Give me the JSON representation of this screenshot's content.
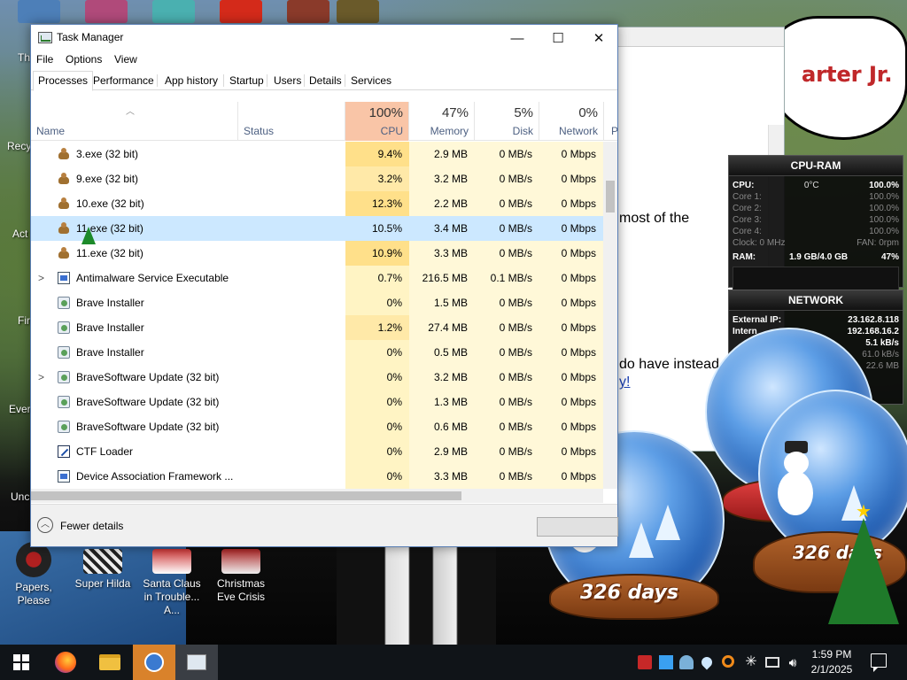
{
  "window": {
    "title": "Task Manager",
    "minimize_label": "—",
    "maximize_label": "☐",
    "close_label": "✕"
  },
  "menu": [
    "File",
    "Options",
    "View"
  ],
  "tabs": [
    "Processes",
    "Performance",
    "App history",
    "Startup",
    "Users",
    "Details",
    "Services"
  ],
  "active_tab": "Processes",
  "columns": {
    "name": "Name",
    "status": "Status",
    "cpu": {
      "pct": "100%",
      "label": "CPU"
    },
    "memory": {
      "pct": "47%",
      "label": "Memory"
    },
    "disk": {
      "pct": "5%",
      "label": "Disk"
    },
    "network": {
      "pct": "0%",
      "label": "Network"
    },
    "power_partial": "P"
  },
  "processes": [
    {
      "name": "3.exe (32 bit)",
      "icon": "poop-icon",
      "expand": "",
      "cpu": "9.4%",
      "mem": "2.9 MB",
      "disk": "0 MB/s",
      "net": "0 Mbps"
    },
    {
      "name": "9.exe (32 bit)",
      "icon": "poop-icon",
      "expand": "",
      "cpu": "3.2%",
      "mem": "3.2 MB",
      "disk": "0 MB/s",
      "net": "0 Mbps"
    },
    {
      "name": "10.exe (32 bit)",
      "icon": "poop-icon",
      "expand": "",
      "cpu": "12.3%",
      "mem": "2.2 MB",
      "disk": "0 MB/s",
      "net": "0 Mbps"
    },
    {
      "name": "11.exe (32 bit)",
      "icon": "poop-icon",
      "expand": "",
      "cpu": "10.5%",
      "mem": "3.4 MB",
      "disk": "0 MB/s",
      "net": "0 Mbps"
    },
    {
      "name": "11.exe (32 bit)",
      "icon": "poop-icon",
      "expand": "",
      "cpu": "10.9%",
      "mem": "3.3 MB",
      "disk": "0 MB/s",
      "net": "0 Mbps"
    },
    {
      "name": "Antimalware Service Executable",
      "icon": "app-window-icon",
      "expand": ">",
      "cpu": "0.7%",
      "mem": "216.5 MB",
      "disk": "0.1 MB/s",
      "net": "0 Mbps"
    },
    {
      "name": "Brave Installer",
      "icon": "installer-icon",
      "expand": "",
      "cpu": "0%",
      "mem": "1.5 MB",
      "disk": "0 MB/s",
      "net": "0 Mbps"
    },
    {
      "name": "Brave Installer",
      "icon": "installer-icon",
      "expand": "",
      "cpu": "1.2%",
      "mem": "27.4 MB",
      "disk": "0 MB/s",
      "net": "0 Mbps"
    },
    {
      "name": "Brave Installer",
      "icon": "installer-icon",
      "expand": "",
      "cpu": "0%",
      "mem": "0.5 MB",
      "disk": "0 MB/s",
      "net": "0 Mbps"
    },
    {
      "name": "BraveSoftware Update (32 bit)",
      "icon": "installer-icon",
      "expand": ">",
      "cpu": "0%",
      "mem": "3.2 MB",
      "disk": "0 MB/s",
      "net": "0 Mbps"
    },
    {
      "name": "BraveSoftware Update (32 bit)",
      "icon": "installer-icon",
      "expand": "",
      "cpu": "0%",
      "mem": "1.3 MB",
      "disk": "0 MB/s",
      "net": "0 Mbps"
    },
    {
      "name": "BraveSoftware Update (32 bit)",
      "icon": "installer-icon",
      "expand": "",
      "cpu": "0%",
      "mem": "0.6 MB",
      "disk": "0 MB/s",
      "net": "0 Mbps"
    },
    {
      "name": "CTF Loader",
      "icon": "ctf-loader-icon",
      "expand": "",
      "cpu": "0%",
      "mem": "2.9 MB",
      "disk": "0 MB/s",
      "net": "0 Mbps"
    },
    {
      "name": "Device Association Framework ...",
      "icon": "app-window-icon",
      "expand": "",
      "cpu": "0%",
      "mem": "3.3 MB",
      "disk": "0 MB/s",
      "net": "0 Mbps"
    }
  ],
  "selected_row": 3,
  "footer": {
    "fewer_details": "Fewer details"
  },
  "cpu_ram_gadget": {
    "title": "CPU-RAM",
    "cpu_label": "CPU:",
    "temp": "0°C",
    "cpu_total": "100.0%",
    "cores": [
      {
        "label": "Core 1:",
        "value": "100.0%"
      },
      {
        "label": "Core 2:",
        "value": "100.0%"
      },
      {
        "label": "Core 3:",
        "value": "100.0%"
      },
      {
        "label": "Core 4:",
        "value": "100.0%"
      }
    ],
    "clock": "Clock: 0 MHz",
    "fan": "FAN: 0rpm",
    "ram_label": "RAM:",
    "ram_value": "1.9 GB/4.0 GB",
    "ram_pct": "47%"
  },
  "network_gadget": {
    "title": "NETWORK",
    "external_ip_label": "External IP:",
    "external_ip": "23.162.8.118",
    "internal_ip_label": "Intern",
    "internal_ip": "192.168.16.2",
    "rate1": "5.1 kB/s",
    "rate2": "61.0 kB/s",
    "rate3": "22.6 MB"
  },
  "background_window": {
    "bubble_text": "arter Jr.",
    "text1": "most of the",
    "text2": "do have instead",
    "link": "y!"
  },
  "desktop_icons": [
    {
      "label": "Papers, Please"
    },
    {
      "label": "Super Hilda"
    },
    {
      "label": "Santa Claus in Trouble... A..."
    },
    {
      "label": "Christmas Eve Crisis"
    }
  ],
  "desktop_partial_labels": [
    "Th",
    "Recy",
    "Act",
    "Fir",
    "Ever",
    "Unc"
  ],
  "snow_globes": {
    "label": "326 days"
  },
  "taskbar": {
    "time": "1:59 PM",
    "date": "2/1/2025"
  },
  "colors": {
    "cpu_header": "#f9c5a7",
    "cpu_cell": "#fff4c4",
    "selection": "#cce8ff",
    "taskbar": "#101418"
  }
}
